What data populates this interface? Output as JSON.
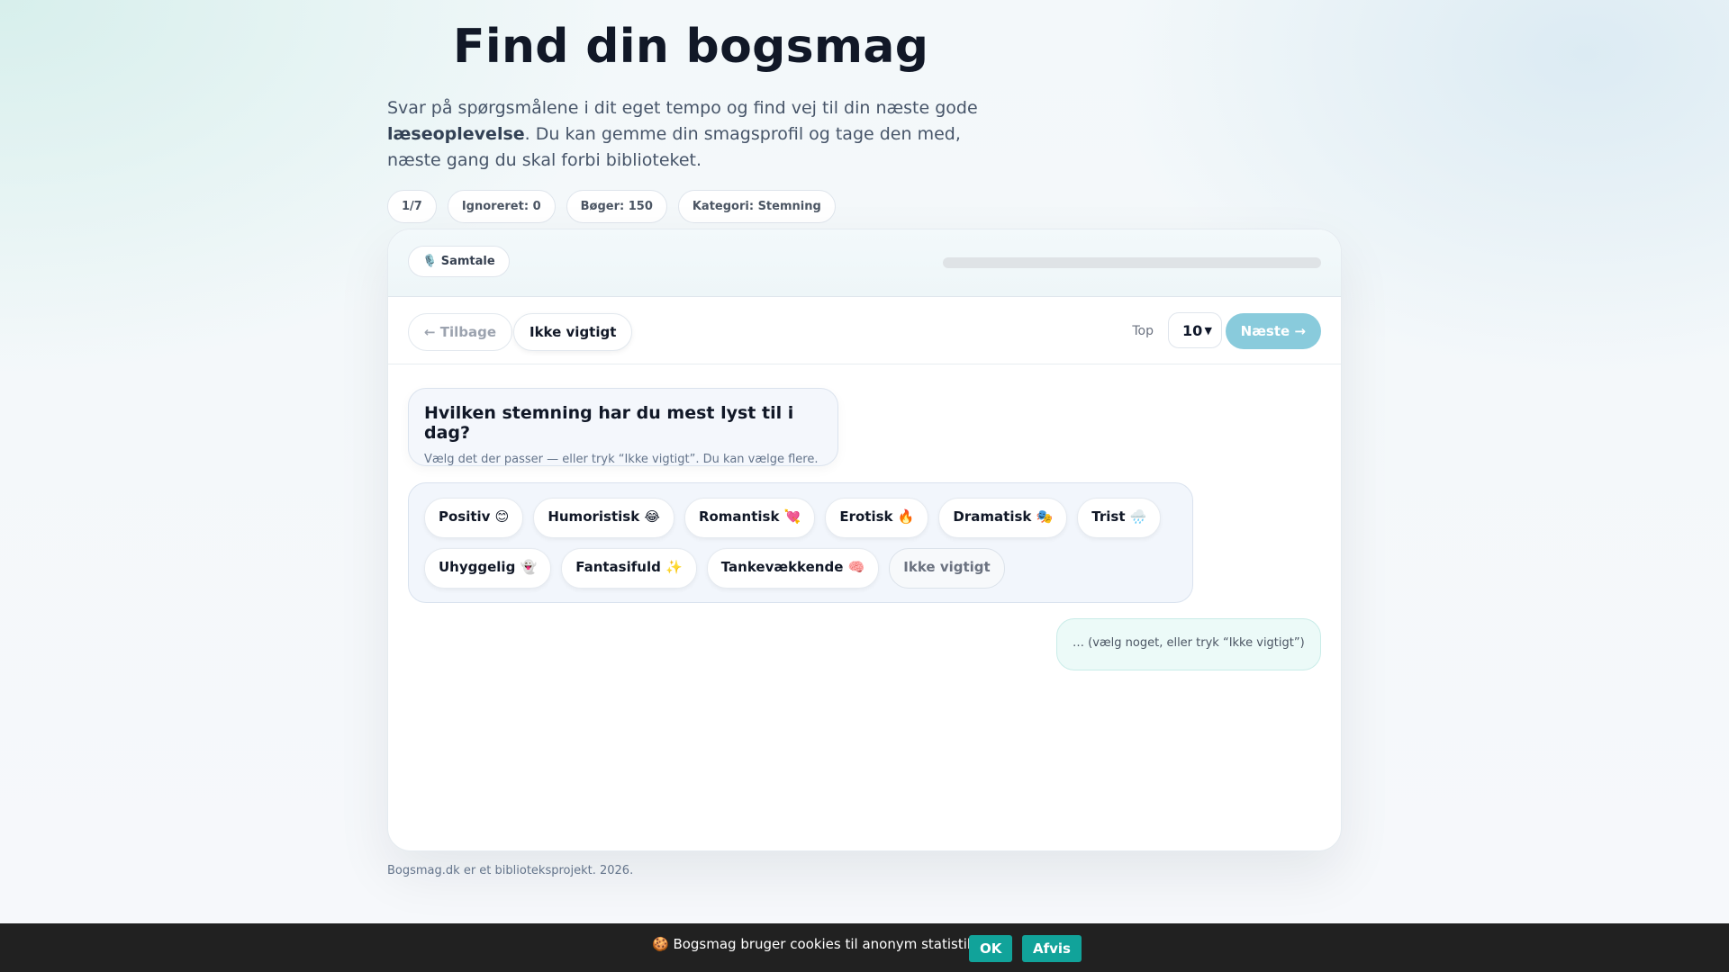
{
  "header": {
    "title": "Find din bogsmag",
    "intro_pre": "Svar på spørgsmålene i dit eget tempo og find vej til din næste gode",
    "intro_bold": "læseoplevelse",
    "intro_post": ". Du kan gemme din smagsprofil og tage den med, næste gang du skal forbi biblioteket."
  },
  "stats": [
    "1/7",
    "Ignoreret: 0",
    "Bøger: 150",
    "Kategori: Stemning"
  ],
  "card": {
    "mode_label": "🎙️ Samtale",
    "progress_fraction": 0.0,
    "progress_color": "#11a39a"
  },
  "toolbar": {
    "back_label": "← Tilbage",
    "skip_label": "Ikke vigtigt",
    "top_label": "Top",
    "top_value": "10",
    "next_label": "Næste →"
  },
  "question": {
    "title": "Hvilken stemning har du mest lyst til i dag?",
    "subtitle": "Vælg det der passer — eller tryk “Ikke vigtigt”. Du kan vælge flere."
  },
  "options": [
    "Positiv 😊",
    "Humoristisk 😂",
    "Romantisk 💘",
    "Erotisk 🔥",
    "Dramatisk 🎭",
    "Trist 🌧️",
    "Uhyggelig 👻",
    "Fantasifuld ✨",
    "Tankevækkende 🧠",
    "Ikke vigtigt"
  ],
  "reply_placeholder": "… (vælg noget, eller tryk “Ikke vigtigt”)",
  "footer_text": "Bogsmag.dk er et biblioteksprojekt. 2026.",
  "cookie": {
    "text": "🍪 Bogsmag bruger cookies til anonym statistik.",
    "ok_label": "OK",
    "decline_label": "Afvis"
  },
  "colors": {
    "accent": "#11a39a",
    "next_button": "#89cbdc",
    "cookie_bar": "#212121"
  }
}
